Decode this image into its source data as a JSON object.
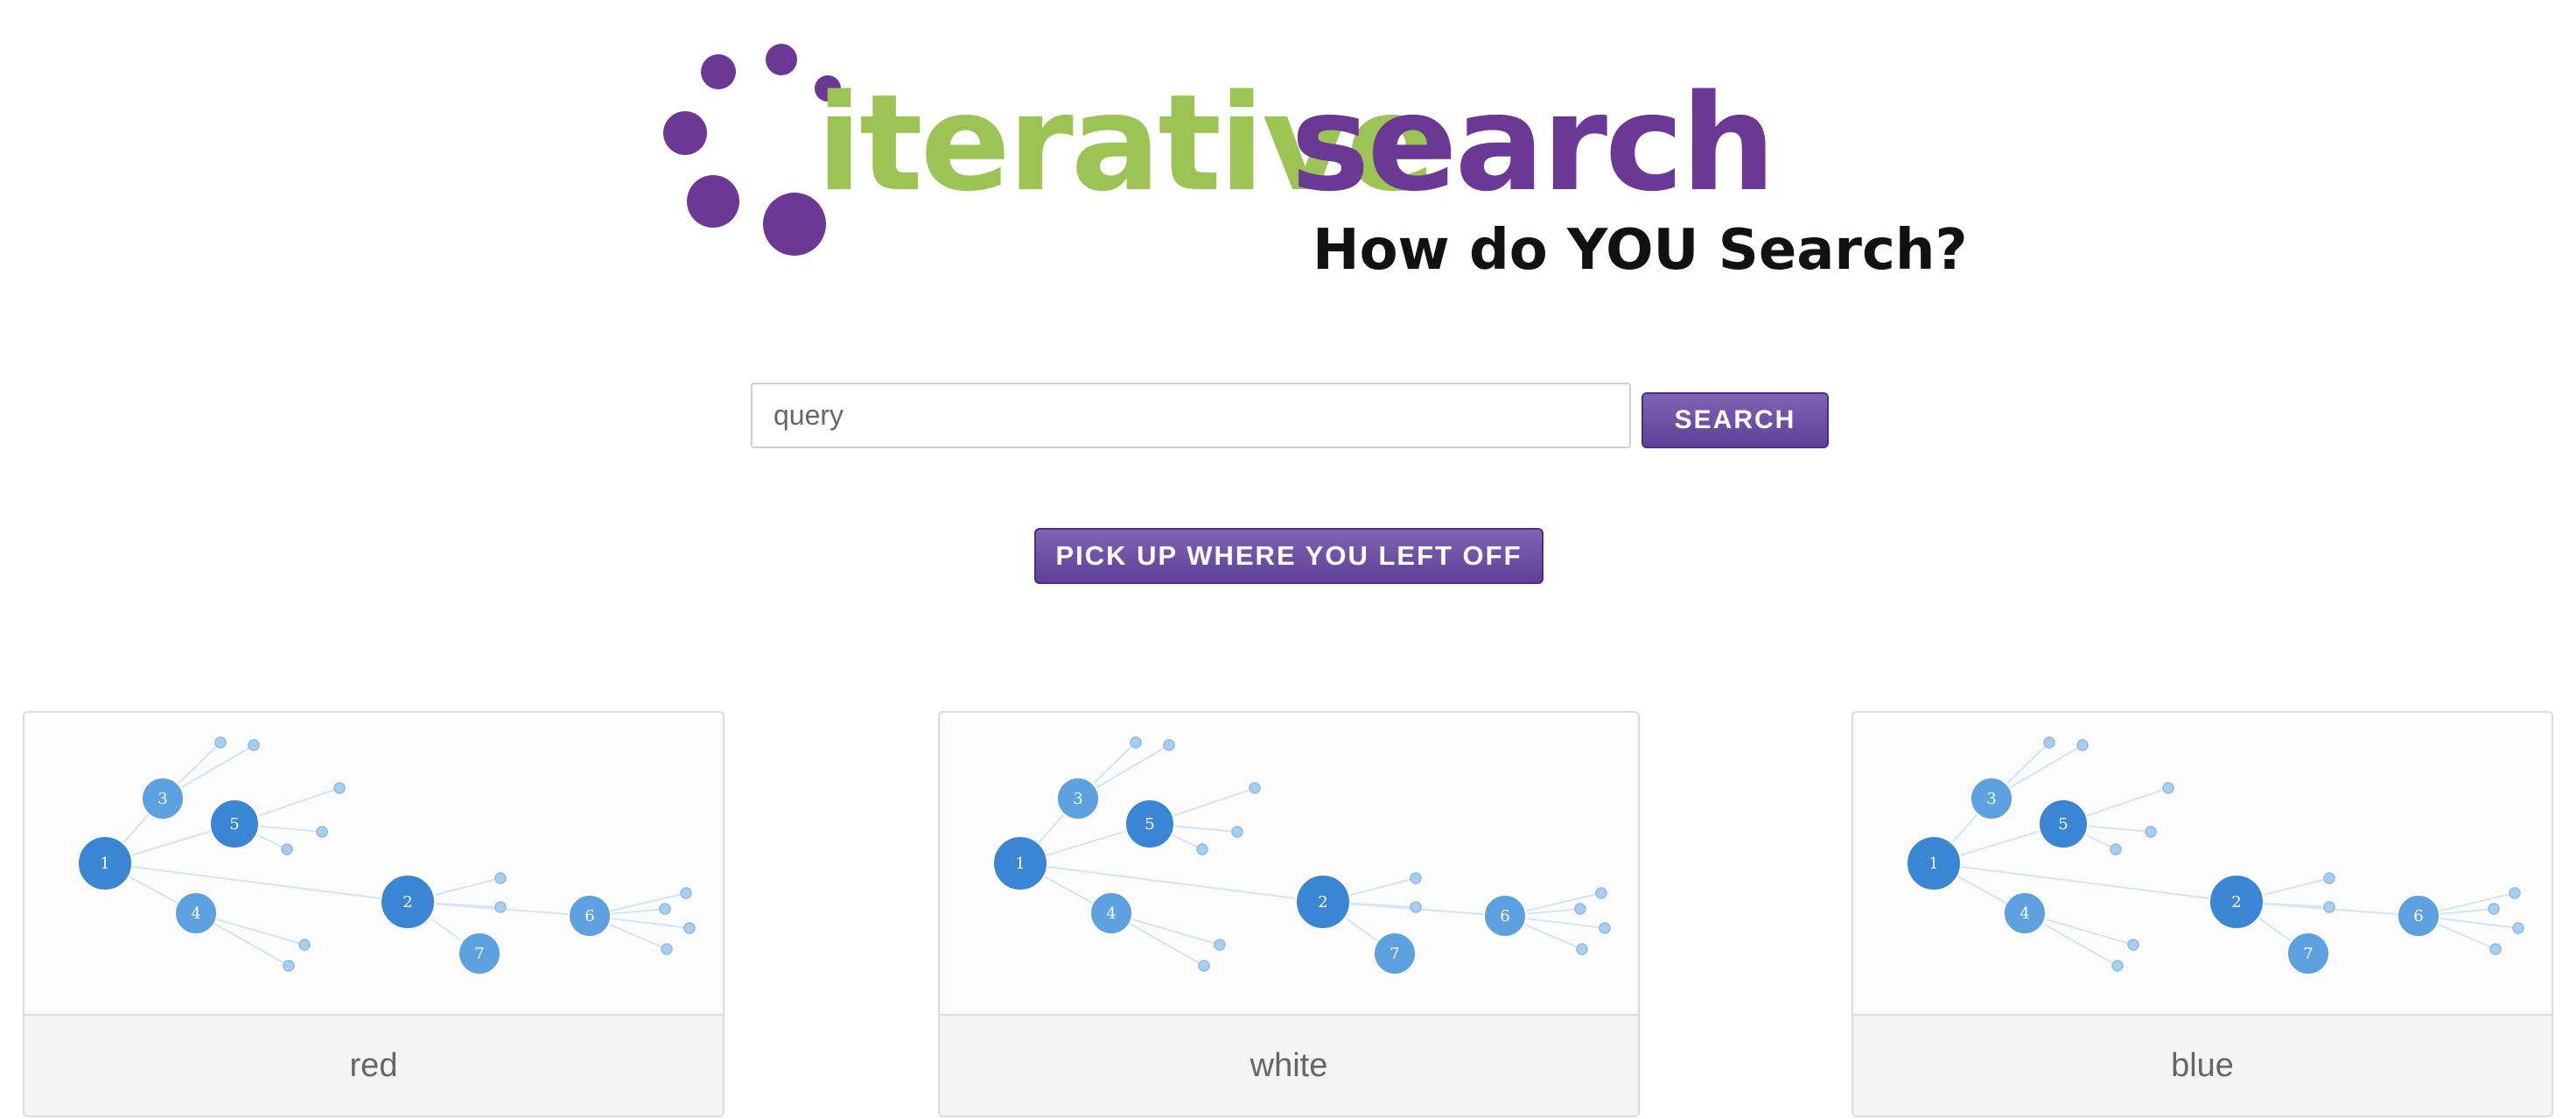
{
  "header": {
    "logo": {
      "word_1": "iterative",
      "word_2": "search"
    },
    "tagline": "How do YOU Search?"
  },
  "search": {
    "placeholder": "query",
    "value": "",
    "button_label": "SEARCH"
  },
  "resume_button_label": "PICK UP WHERE YOU LEFT OFF",
  "cards": [
    {
      "label": "red"
    },
    {
      "label": "white"
    },
    {
      "label": "blue"
    }
  ],
  "graph": {
    "node_labels": [
      "1",
      "2",
      "3",
      "4",
      "5",
      "6",
      "7"
    ]
  },
  "colors": {
    "brand_green": "#9bc454",
    "brand_purple": "#6b3896",
    "button_purple": "#6a4aa7",
    "node_blue": "#3a86d4",
    "node_light_blue": "#5ea1e0",
    "leaf_blue": "#a9cdef"
  }
}
